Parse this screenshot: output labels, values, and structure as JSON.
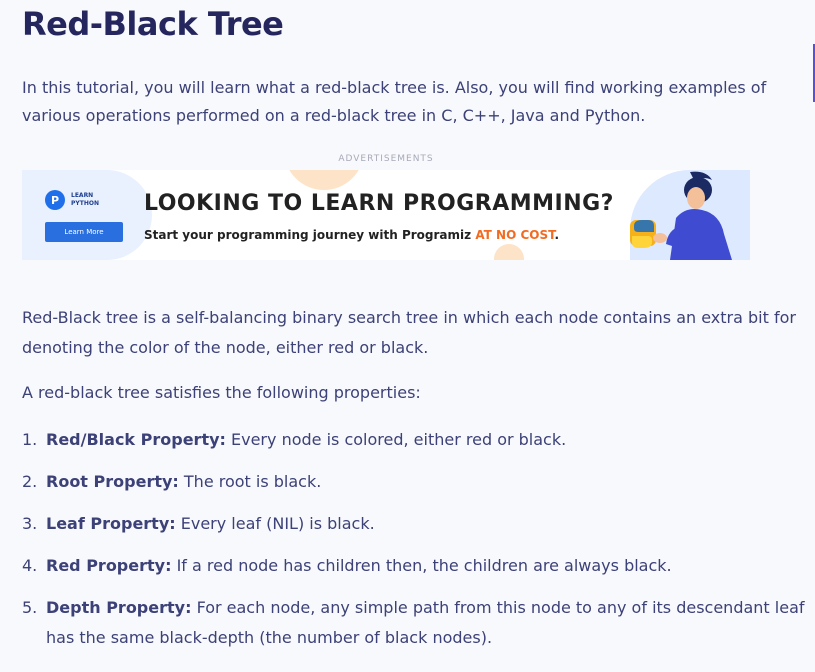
{
  "page": {
    "title": "Red-Black Tree",
    "intro": "In this tutorial, you will learn what a red-black tree is. Also, you will find working examples of various operations performed on a red-black tree in C, C++, Java and Python.",
    "ads_label": "ADVERTISEMENTS"
  },
  "ad": {
    "logo_mark": "P",
    "logo_line1": "LEARN",
    "logo_line2": "PYTHON",
    "cta": "Learn More",
    "headline": "LOOKING TO LEARN PROGRAMMING?",
    "sub_prefix": "Start your programming journey with Programiz ",
    "sub_accent": "AT NO COST",
    "sub_suffix": ".",
    "accent_color": "#f26b21"
  },
  "content": {
    "paragraph1": "Red-Black tree is a self-balancing binary search tree in which each node contains an extra bit for denoting the color of the node, either red or black.",
    "paragraph2": "A red-black tree satisfies the following properties:",
    "properties": [
      {
        "num": "1.",
        "term": "Red/Black Property:",
        "text": " Every node is colored, either red or black."
      },
      {
        "num": "2.",
        "term": "Root Property:",
        "text": " The root is black."
      },
      {
        "num": "3.",
        "term": "Leaf Property:",
        "text": " Every leaf (NIL) is black."
      },
      {
        "num": "4.",
        "term": "Red Property:",
        "text": " If a red node has children then, the children are always black."
      },
      {
        "num": "5.",
        "term": "Depth Property:",
        "text": " For each node, any simple path from this node to any of its descendant leaf has the same black-depth (the number of black nodes)."
      }
    ]
  },
  "colors": {
    "heading": "#25265e",
    "body_text": "#3c4178",
    "background": "#f8f9fc",
    "ad_cta_bg": "#2a6fe0"
  }
}
